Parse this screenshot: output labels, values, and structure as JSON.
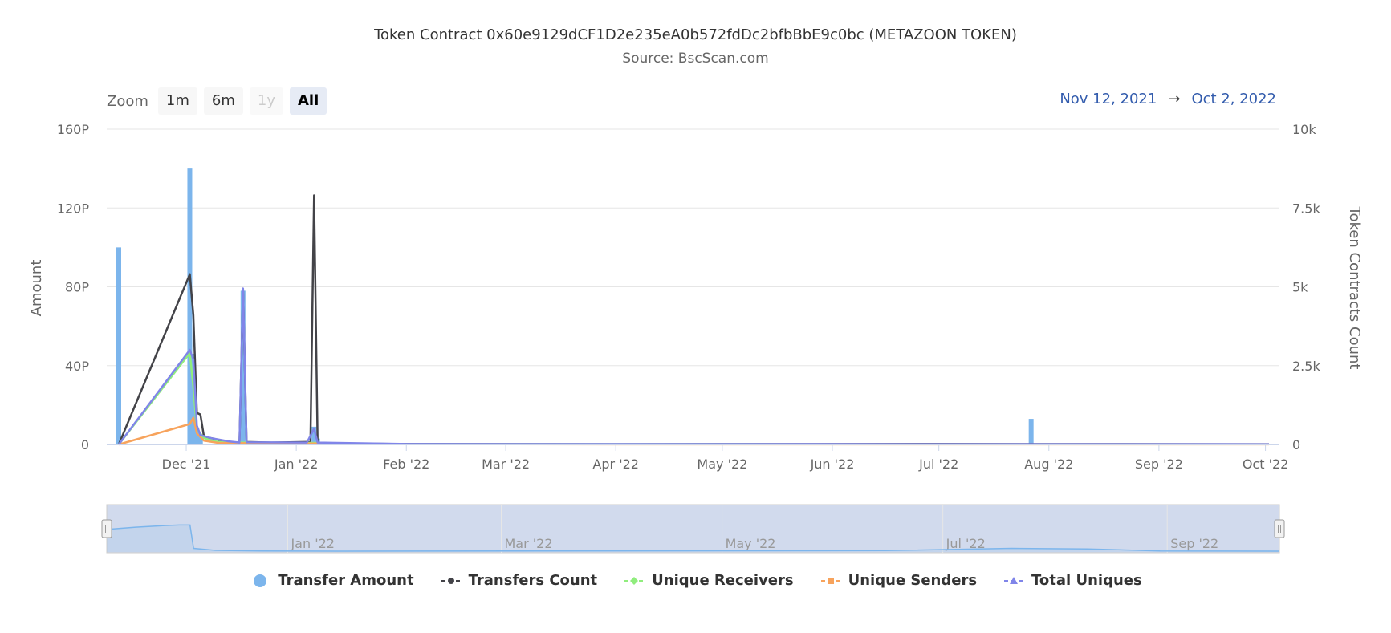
{
  "header": {
    "title": "Token Contract 0x60e9129dCF1D2e235eA0b572fdDc2bfbBbE9c0bc (METAZOON TOKEN)",
    "subtitle": "Source: BscScan.com"
  },
  "zoom": {
    "label": "Zoom",
    "buttons": [
      {
        "label": "1m",
        "state": "normal"
      },
      {
        "label": "6m",
        "state": "normal"
      },
      {
        "label": "1y",
        "state": "disabled"
      },
      {
        "label": "All",
        "state": "active"
      }
    ]
  },
  "range": {
    "from": "Nov 12, 2021",
    "arrow": "→",
    "to": "Oct 2, 2022"
  },
  "chart_data": {
    "type": "bar",
    "title": "Token Contract 0x60e9129dCF1D2e235eA0b572fdDc2bfbBbE9c0bc (METAZOON TOKEN)",
    "subtitle": "Source: BscScan.com",
    "x_range": [
      "2021-11-12",
      "2022-10-02"
    ],
    "x_ticks": [
      {
        "date": "2021-12-01",
        "label": "Dec '21"
      },
      {
        "date": "2022-01-01",
        "label": "Jan '22"
      },
      {
        "date": "2022-02-01",
        "label": "Feb '22"
      },
      {
        "date": "2022-03-01",
        "label": "Mar '22"
      },
      {
        "date": "2022-04-01",
        "label": "Apr '22"
      },
      {
        "date": "2022-05-01",
        "label": "May '22"
      },
      {
        "date": "2022-06-01",
        "label": "Jun '22"
      },
      {
        "date": "2022-07-01",
        "label": "Jul '22"
      },
      {
        "date": "2022-08-01",
        "label": "Aug '22"
      },
      {
        "date": "2022-09-01",
        "label": "Sep '22"
      },
      {
        "date": "2022-10-01",
        "label": "Oct '22"
      }
    ],
    "y_left": {
      "label": "Amount",
      "unit": "P",
      "range": [
        0,
        160
      ],
      "ticks": [
        0,
        40,
        80,
        120,
        160
      ],
      "tick_labels": [
        "0",
        "40P",
        "80P",
        "120P",
        "160P"
      ]
    },
    "y_right": {
      "label": "Token Contracts Count",
      "range": [
        0,
        10000
      ],
      "ticks": [
        0,
        2500,
        5000,
        7500,
        10000
      ],
      "tick_labels": [
        "0",
        "2.5k",
        "5k",
        "7.5k",
        "10k"
      ]
    },
    "grid": true,
    "legend_position": "bottom-center",
    "series": [
      {
        "name": "Transfer Amount",
        "kind": "column",
        "axis": "left",
        "color": "#7cb5ec",
        "marker": "circle",
        "points": [
          {
            "date": "2021-11-12",
            "value": 100
          },
          {
            "date": "2021-12-02",
            "value": 140
          },
          {
            "date": "2021-12-03",
            "value": 46
          },
          {
            "date": "2021-12-04",
            "value": 8
          },
          {
            "date": "2021-12-05",
            "value": 4
          },
          {
            "date": "2021-12-17",
            "value": 78
          },
          {
            "date": "2022-01-06",
            "value": 9
          },
          {
            "date": "2022-01-07",
            "value": 3
          },
          {
            "date": "2022-07-27",
            "value": 13
          }
        ]
      },
      {
        "name": "Transfers Count",
        "kind": "line",
        "axis": "right",
        "color": "#434348",
        "marker": "circle",
        "points": [
          {
            "date": "2021-11-12",
            "value": 0
          },
          {
            "date": "2021-12-02",
            "value": 5400
          },
          {
            "date": "2021-12-03",
            "value": 4100
          },
          {
            "date": "2021-12-04",
            "value": 1000
          },
          {
            "date": "2021-12-05",
            "value": 950
          },
          {
            "date": "2021-12-06",
            "value": 250
          },
          {
            "date": "2021-12-08",
            "value": 200
          },
          {
            "date": "2021-12-10",
            "value": 150
          },
          {
            "date": "2021-12-13",
            "value": 80
          },
          {
            "date": "2021-12-16",
            "value": 60
          },
          {
            "date": "2021-12-17",
            "value": 4900
          },
          {
            "date": "2021-12-18",
            "value": 80
          },
          {
            "date": "2021-12-25",
            "value": 60
          },
          {
            "date": "2022-01-04",
            "value": 80
          },
          {
            "date": "2022-01-05",
            "value": 60
          },
          {
            "date": "2022-01-06",
            "value": 7900
          },
          {
            "date": "2022-01-07",
            "value": 60
          },
          {
            "date": "2022-01-12",
            "value": 30
          },
          {
            "date": "2022-02-01",
            "value": 15
          },
          {
            "date": "2022-04-01",
            "value": 10
          },
          {
            "date": "2022-07-01",
            "value": 15
          },
          {
            "date": "2022-10-02",
            "value": 10
          }
        ]
      },
      {
        "name": "Unique Receivers",
        "kind": "line",
        "axis": "right",
        "color": "#90ed7d",
        "marker": "diamond",
        "points": [
          {
            "date": "2021-11-12",
            "value": 0
          },
          {
            "date": "2021-12-02",
            "value": 2900
          },
          {
            "date": "2021-12-03",
            "value": 1800
          },
          {
            "date": "2021-12-04",
            "value": 500
          },
          {
            "date": "2021-12-06",
            "value": 200
          },
          {
            "date": "2021-12-10",
            "value": 80
          },
          {
            "date": "2021-12-17",
            "value": 60
          },
          {
            "date": "2022-01-06",
            "value": 50
          },
          {
            "date": "2022-02-01",
            "value": 10
          },
          {
            "date": "2022-10-02",
            "value": 5
          }
        ]
      },
      {
        "name": "Unique Senders",
        "kind": "line",
        "axis": "right",
        "color": "#f7a35c",
        "marker": "square",
        "points": [
          {
            "date": "2021-11-12",
            "value": 0
          },
          {
            "date": "2021-12-02",
            "value": 650
          },
          {
            "date": "2021-12-03",
            "value": 850
          },
          {
            "date": "2021-12-04",
            "value": 350
          },
          {
            "date": "2021-12-06",
            "value": 120
          },
          {
            "date": "2021-12-10",
            "value": 50
          },
          {
            "date": "2021-12-17",
            "value": 40
          },
          {
            "date": "2022-01-06",
            "value": 30
          },
          {
            "date": "2022-02-01",
            "value": 5
          },
          {
            "date": "2022-10-02",
            "value": 3
          }
        ]
      },
      {
        "name": "Total Uniques",
        "kind": "line",
        "axis": "right",
        "color": "#8085e9",
        "marker": "triangle",
        "points": [
          {
            "date": "2021-11-12",
            "value": 0
          },
          {
            "date": "2021-12-02",
            "value": 3000
          },
          {
            "date": "2021-12-03",
            "value": 2700
          },
          {
            "date": "2021-12-04",
            "value": 600
          },
          {
            "date": "2021-12-05",
            "value": 300
          },
          {
            "date": "2021-12-08",
            "value": 200
          },
          {
            "date": "2021-12-13",
            "value": 100
          },
          {
            "date": "2021-12-16",
            "value": 60
          },
          {
            "date": "2021-12-17",
            "value": 4950
          },
          {
            "date": "2021-12-18",
            "value": 70
          },
          {
            "date": "2022-01-04",
            "value": 60
          },
          {
            "date": "2022-01-06",
            "value": 500
          },
          {
            "date": "2022-01-07",
            "value": 60
          },
          {
            "date": "2022-02-01",
            "value": 15
          },
          {
            "date": "2022-07-01",
            "value": 10
          },
          {
            "date": "2022-10-02",
            "value": 8
          }
        ]
      }
    ],
    "navigator": {
      "labels": [
        {
          "date": "2022-01-01",
          "label": "Jan '22"
        },
        {
          "date": "2022-03-01",
          "label": "Mar '22"
        },
        {
          "date": "2022-05-01",
          "label": "May '22"
        },
        {
          "date": "2022-07-01",
          "label": "Jul '22"
        },
        {
          "date": "2022-09-01",
          "label": "Sep '22"
        }
      ],
      "selection": [
        "2021-11-12",
        "2022-10-02"
      ],
      "curve": [
        {
          "date": "2021-11-12",
          "value": 0.78
        },
        {
          "date": "2021-11-20",
          "value": 0.86
        },
        {
          "date": "2021-11-28",
          "value": 0.92
        },
        {
          "date": "2021-12-02",
          "value": 0.94
        },
        {
          "date": "2021-12-05",
          "value": 0.94
        },
        {
          "date": "2021-12-06",
          "value": 0.1
        },
        {
          "date": "2021-12-12",
          "value": 0.03
        },
        {
          "date": "2021-12-25",
          "value": 0.01
        },
        {
          "date": "2022-01-15",
          "value": 0.0
        },
        {
          "date": "2022-06-15",
          "value": 0.02
        },
        {
          "date": "2022-07-20",
          "value": 0.1
        },
        {
          "date": "2022-08-10",
          "value": 0.08
        },
        {
          "date": "2022-08-30",
          "value": 0.01
        },
        {
          "date": "2022-10-02",
          "value": 0.0
        }
      ]
    }
  }
}
